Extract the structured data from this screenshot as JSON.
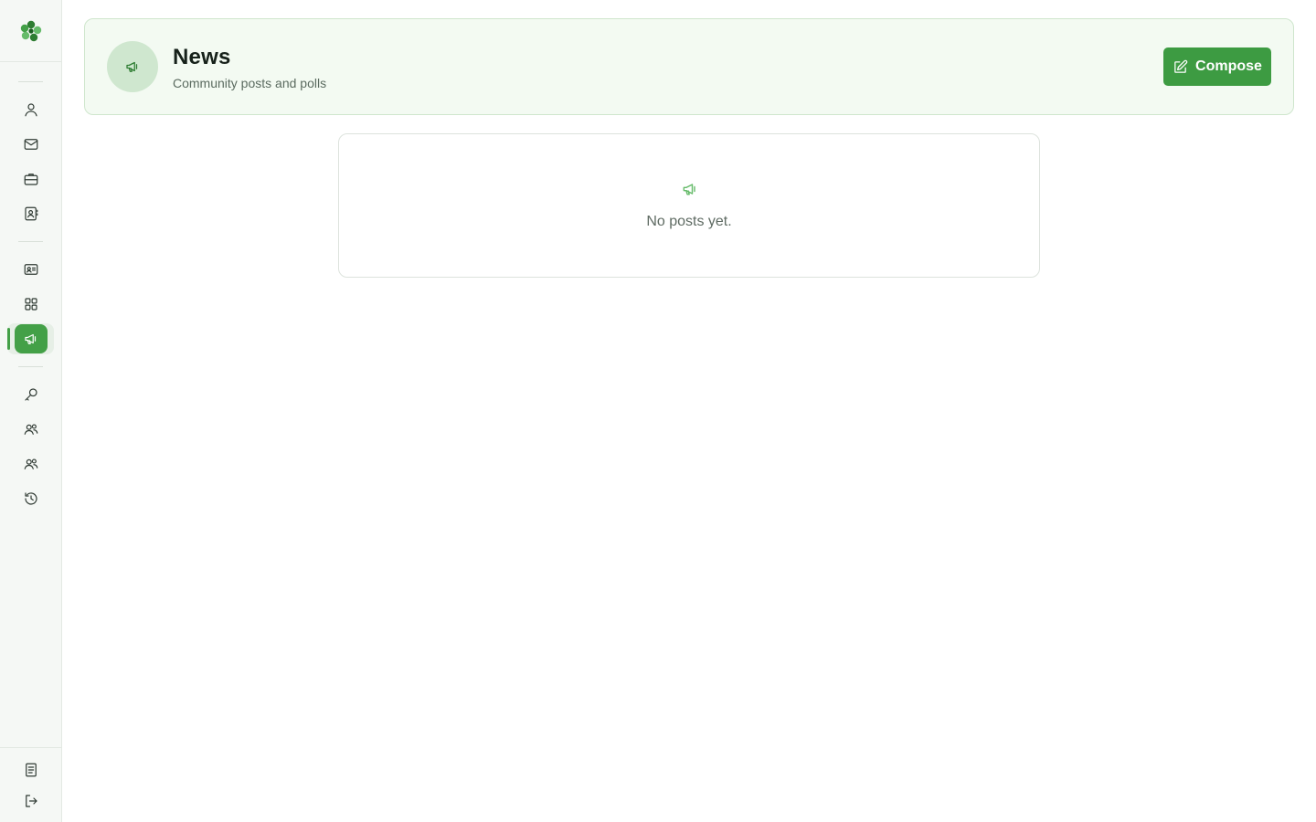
{
  "colors": {
    "accent": "#43a047",
    "header_bg": "#f3faf2",
    "button": "#3d9b42"
  },
  "sidebar": {
    "logo_icon": "clover-logo-icon",
    "items": [
      {
        "name": "profile",
        "icon": "user-icon"
      },
      {
        "name": "messages",
        "icon": "mail-icon"
      },
      {
        "name": "jobs",
        "icon": "briefcase-icon"
      },
      {
        "name": "contacts",
        "icon": "contact-book-icon"
      },
      {
        "name": "id-card",
        "icon": "id-card-icon"
      },
      {
        "name": "apps",
        "icon": "grid-icon"
      },
      {
        "name": "news",
        "icon": "megaphone-icon",
        "active": true
      },
      {
        "name": "keys",
        "icon": "key-icon"
      },
      {
        "name": "groups",
        "icon": "users-icon"
      },
      {
        "name": "members",
        "icon": "users-icon"
      },
      {
        "name": "history",
        "icon": "history-icon"
      },
      {
        "name": "docs",
        "icon": "document-icon"
      },
      {
        "name": "logout",
        "icon": "logout-icon"
      }
    ]
  },
  "header": {
    "title": "News",
    "subtitle": "Community posts and polls",
    "compose_label": "Compose"
  },
  "feed": {
    "empty_text": "No posts yet."
  }
}
